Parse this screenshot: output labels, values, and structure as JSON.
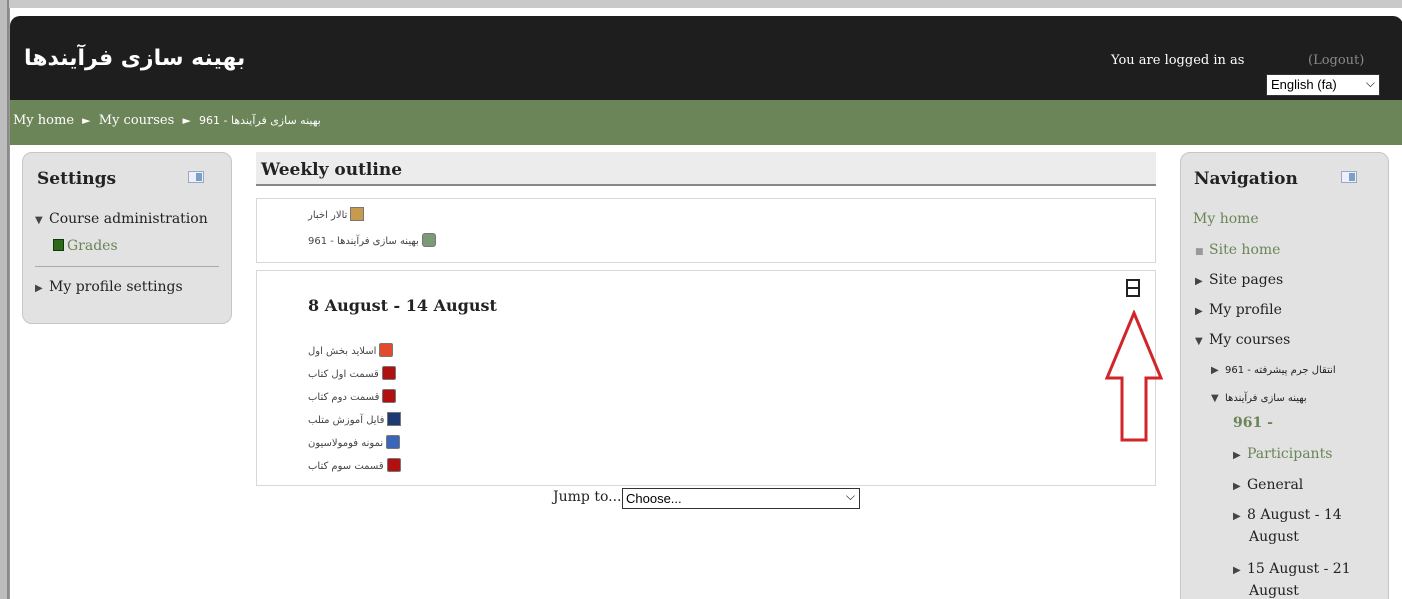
{
  "header": {
    "site_title": "بهینه سازی فرآیندها",
    "login_info": "You are logged in as",
    "logout_label": "(Logout)",
    "language": "English (fa)"
  },
  "breadcrumb": {
    "items": [
      "My home",
      "My courses",
      "بهینه سازی فرآیندها - 961"
    ],
    "separator": "►"
  },
  "settings_block": {
    "title": "Settings",
    "course_admin": "Course administration",
    "grades": "Grades",
    "profile_settings": "My profile settings"
  },
  "main": {
    "title": "Weekly outline",
    "top_activities": [
      "تالار اخبار",
      "بهینه سازی فرآیندها - 961"
    ],
    "week_title": "8 August - 14 August",
    "week_activities": [
      {
        "label": "اسلاید بخش اول",
        "icon": "ppt-icon"
      },
      {
        "label": "قسمت اول کتاب",
        "icon": "pdf-icon"
      },
      {
        "label": "قسمت دوم کتاب",
        "icon": "pdf-icon"
      },
      {
        "label": "فایل آموزش متلب",
        "icon": "book-icon"
      },
      {
        "label": "نمونه فومولاسیون",
        "icon": "doc-icon"
      },
      {
        "label": "قسمت سوم کتاب",
        "icon": "pdf-icon"
      }
    ],
    "jump_label": "Jump to...",
    "jump_value": "Choose..."
  },
  "navigation_block": {
    "title": "Navigation",
    "my_home": "My home",
    "site_home": "Site home",
    "site_pages": "Site pages",
    "my_profile": "My profile",
    "my_courses": "My courses",
    "course1": "انتقال جرم پیشرفته - 961",
    "course2_a": "بهینه سازی فرآیندها",
    "course2_b": "961 -",
    "participants": "Participants",
    "general": "General",
    "week1_a": "8 August - 14",
    "week1_b": "August",
    "week2_a": "15 August - 21",
    "week2_b": "August"
  },
  "colors": {
    "header_bg": "#1e1e1e",
    "navbar_bg": "#6b8458",
    "link_green": "#6b8458",
    "annotation_arrow": "#d0262a"
  }
}
